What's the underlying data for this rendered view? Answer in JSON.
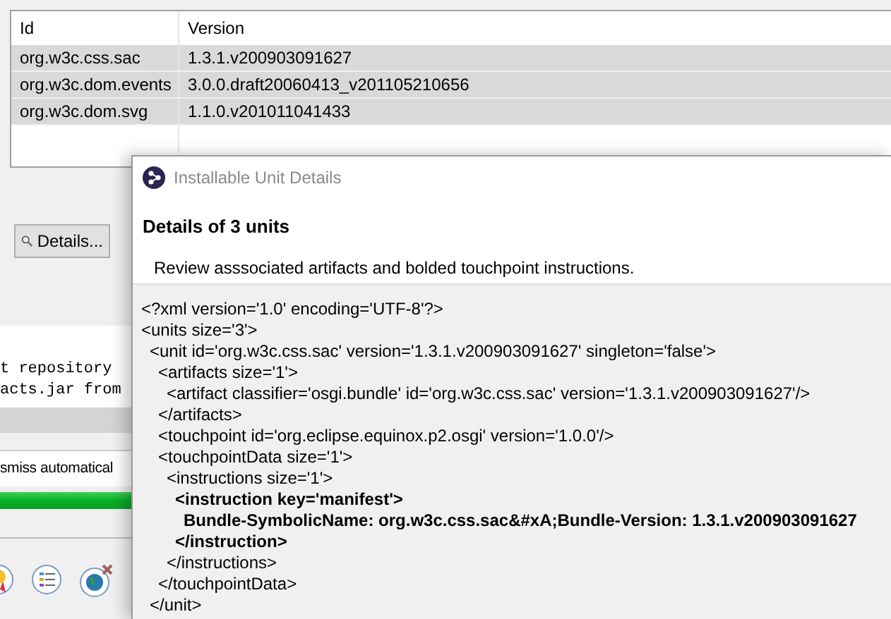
{
  "table": {
    "columns": [
      "Id",
      "Version"
    ],
    "rows": [
      {
        "id": "org.w3c.css.sac",
        "version": "1.3.1.v200903091627"
      },
      {
        "id": "org.w3c.dom.events",
        "version": "3.0.0.draft20060413_v201105210656"
      },
      {
        "id": "org.w3c.dom.svg",
        "version": "1.1.0.v201011041433"
      }
    ]
  },
  "details_button": "Details...",
  "console_lines": [
    "t repository",
    "acts.jar from"
  ],
  "dismiss_text": "smiss automatical",
  "progress": {
    "level": 1
  },
  "dialog": {
    "title": "Installable Unit Details",
    "heading": "Details of 3 units",
    "description": "Review asssociated artifacts and bolded touchpoint instructions.",
    "xml": [
      {
        "text": "<?xml version='1.0' encoding='UTF-8'?>",
        "bold": false
      },
      {
        "text": "<units size='3'>",
        "bold": false,
        "children": [
          {
            "text": "<unit id='org.w3c.css.sac' version='1.3.1.v200903091627' singleton='false'>",
            "bold": false,
            "children": [
              {
                "text": "<artifacts size='1'>",
                "bold": false,
                "children": [
                  {
                    "text": "<artifact classifier='osgi.bundle' id='org.w3c.css.sac' version='1.3.1.v200903091627'/>",
                    "bold": false
                  }
                ]
              },
              {
                "text": "</artifacts>",
                "bold": false
              },
              {
                "text": "<touchpoint id='org.eclipse.equinox.p2.osgi' version='1.0.0'/>",
                "bold": false
              },
              {
                "text": "<touchpointData size='1'>",
                "bold": false,
                "children": [
                  {
                    "text": "<instructions size='1'>",
                    "bold": false,
                    "children": [
                      {
                        "text": "<instruction key='manifest'>",
                        "bold": true,
                        "children": [
                          {
                            "text": "Bundle-SymbolicName: org.w3c.css.sac&#xA;Bundle-Version: 1.3.1.v200903091627",
                            "bold": true
                          }
                        ]
                      },
                      {
                        "text": "</instruction>",
                        "bold": true
                      }
                    ]
                  },
                  {
                    "text": "</instructions>",
                    "bold": false
                  }
                ]
              },
              {
                "text": "</touchpointData>",
                "bold": false
              }
            ]
          },
          {
            "text": "</unit>",
            "bold": false
          }
        ]
      }
    ]
  }
}
